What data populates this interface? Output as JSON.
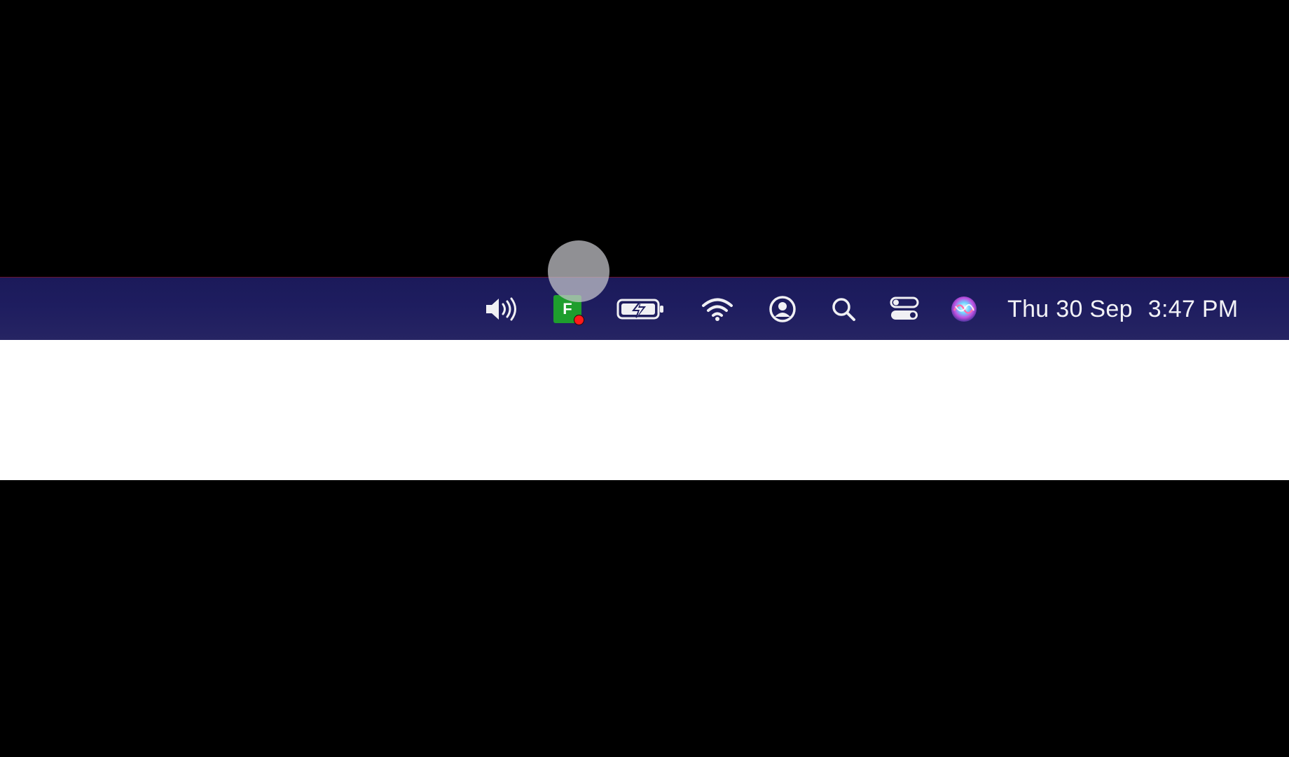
{
  "menubar": {
    "status_items": [
      {
        "name": "volume-icon"
      },
      {
        "name": "app-f-icon",
        "label": "F"
      },
      {
        "name": "battery-charging-icon"
      },
      {
        "name": "wifi-icon"
      },
      {
        "name": "user-account-icon"
      },
      {
        "name": "spotlight-search-icon"
      },
      {
        "name": "control-center-icon"
      },
      {
        "name": "siri-icon"
      }
    ],
    "date": "Thu 30 Sep",
    "time": "3:47 PM"
  },
  "colors": {
    "menubar_bg": "#1e1d5f",
    "app_f_green": "#1e9e2d",
    "badge_red": "#ff1a1a",
    "band_white": "#ffffff"
  }
}
